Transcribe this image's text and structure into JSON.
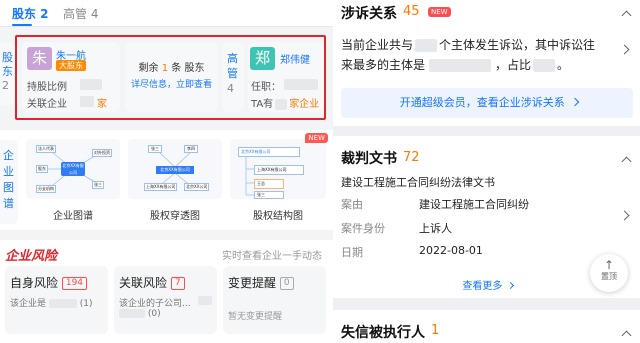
{
  "left": {
    "tabs": [
      "股东 2",
      "高管 4"
    ],
    "side_labels": {
      "shareholder": [
        "股",
        "东",
        "2"
      ],
      "exec": [
        "高",
        "管",
        "4"
      ]
    },
    "shareholder": {
      "avatar": "朱",
      "name": "朱一航",
      "badge": "大股东",
      "hold_label": "持股比例",
      "related_label": "关联企业",
      "related_unit": "家"
    },
    "mid": {
      "line_prefix": "剩余",
      "count": "1",
      "line_suffix": "条 股东",
      "link": "详尽信息，立即查看"
    },
    "exec": {
      "avatar": "郑",
      "name": "郑伟健",
      "role_label": "任职：",
      "related_prefix": "TA有",
      "related_suffix": "家企业"
    },
    "graph_side": [
      "企",
      "业",
      "图",
      "谱"
    ],
    "graphs": {
      "g1": "企业图谱",
      "g2": "股权穿透图",
      "g3": "股权结构图",
      "new": "NEW",
      "mini": {
        "center": "北京XX有限公司",
        "legal": "法人代表",
        "invest": "对外投资",
        "holder": "股东",
        "branch": "分支机构",
        "co1": "上海XX有限公司",
        "co2": "北京XX公司",
        "n1": "张三",
        "n2": "李四",
        "n3": "王总",
        "c1": "北京XX有限公司"
      }
    },
    "risk": {
      "title": "企业风险",
      "slogan": "实时查看企业一手动态",
      "items": [
        {
          "name": "自身风险",
          "count": "194",
          "desc": "该企业是",
          "tail": "(1)"
        },
        {
          "name": "关联风险",
          "count": "7",
          "desc": "该企业的子公司...",
          "tail": "(0)"
        },
        {
          "name": "变更提醒",
          "count": "0",
          "desc": "暂无变更提醒",
          "tail": ""
        }
      ]
    }
  },
  "right": {
    "lawsuit": {
      "title": "涉诉关系",
      "count": "45",
      "new": "NEW",
      "line1a": "当前企业共与",
      "line1b": "个主体发生诉讼，其中诉讼往",
      "line2a": "来最多的主体是",
      "line2b": "，占比",
      "line2c": "。",
      "vip": "开通超级会员，查看企业涉诉关系"
    },
    "judgment": {
      "title": "裁判文书",
      "count": "72",
      "doc_title": "建设工程施工合同纠纷法律文书",
      "rows": [
        {
          "k": "案由",
          "v": "建设工程施工合同纠纷"
        },
        {
          "k": "案件身份",
          "v": "上诉人"
        },
        {
          "k": "日期",
          "v": "2022-08-01"
        }
      ],
      "more": "查看更多",
      "top": "置顶"
    },
    "dishonest": {
      "title": "失信被执行人",
      "count": "1"
    }
  },
  "colors": {
    "accent": "#1677ff",
    "orange": "#ff7a00",
    "red": "#ff4d4f",
    "highlight": "#e0252b"
  }
}
